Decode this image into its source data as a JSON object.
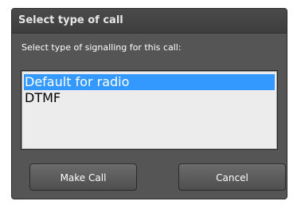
{
  "dialog": {
    "title": "Select type of call",
    "prompt": "Select type of signalling for this call:",
    "options": [
      {
        "label": "Default for radio",
        "selected": true
      },
      {
        "label": "DTMF",
        "selected": false
      }
    ],
    "buttons": {
      "make_call": "Make Call",
      "cancel": "Cancel"
    }
  },
  "colors": {
    "dialog_bg": "#555556",
    "selection": "#3399ff",
    "list_bg": "#ececec"
  }
}
